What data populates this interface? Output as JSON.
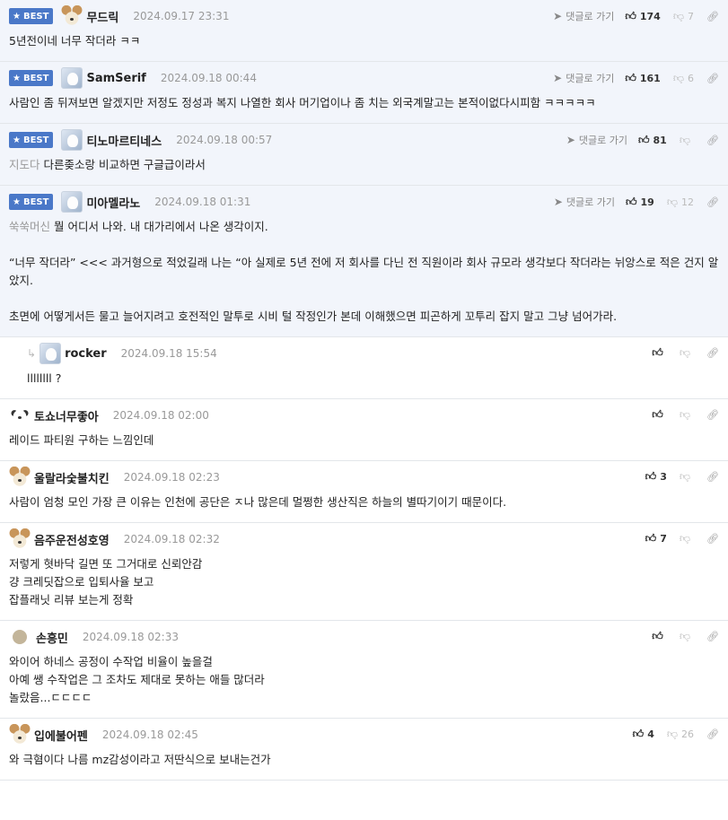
{
  "labels": {
    "best": "BEST",
    "reply": "댓글로 가기"
  },
  "comments": [
    {
      "best": true,
      "avatar": "dog",
      "name": "무드릭",
      "date": "2024.09.17 23:31",
      "up": "174",
      "down": "7",
      "quote": "",
      "text": "5년전이네 너무 작더라 ㅋㅋ"
    },
    {
      "best": true,
      "avatar": "photo",
      "name": "SamSerif",
      "date": "2024.09.18 00:44",
      "up": "161",
      "down": "6",
      "quote": "",
      "text": "사람인 좀 뒤져보면 알겠지만 저정도 정성과 복지 나열한 회사 머기업이나 좀 치는 외국계말고는 본적이없다시피함 ㅋㅋㅋㅋㅋ"
    },
    {
      "best": true,
      "avatar": "photo",
      "name": "티노마르티네스",
      "date": "2024.09.18 00:57",
      "up": "81",
      "down": "",
      "quote": "지도다",
      "text": " 다른좆소랑 비교하면 구글급이라서"
    },
    {
      "best": true,
      "avatar": "photo",
      "name": "미아멜라노",
      "date": "2024.09.18 01:31",
      "up": "19",
      "down": "12",
      "quote": "쑥쑥머신",
      "text": " 뭘 어디서 나와. 내 대가리에서 나온 생각이지.\n\n“너무 작더라” <<< 과거형으로 적었길래 나는 “아 실제로 5년 전에 저 회사를 다닌 전 직원이라 회사 규모라 생각보다 작더라는 뉘앙스로 적은 건지 알았지.\n\n초면에 어떻게서든 물고 늘어지려고 호전적인 말투로 시비 털 작정인가 본데 이해했으면 피곤하게 꼬투리 잡지 말고 그냥 넘어가라."
    },
    {
      "best": false,
      "reply": true,
      "avatar": "photo",
      "name": "rocker",
      "date": "2024.09.18 15:54",
      "up": "",
      "down": "",
      "quote": "",
      "text": "llllllll ?"
    },
    {
      "best": false,
      "avatar": "puppy",
      "name": "토쇼너무좋아",
      "date": "2024.09.18 02:00",
      "up": "",
      "down": "",
      "quote": "",
      "text": "레이드 파티원 구하는 느낌인데"
    },
    {
      "best": false,
      "avatar": "dog",
      "name": "울랄라숯불치킨",
      "date": "2024.09.18 02:23",
      "up": "3",
      "down": "",
      "quote": "",
      "text": "사람이 엄청 모인 가장 큰 이유는 인천에 공단은 ㅈ나 많은데 멀쩡한 생산직은 하늘의 별따기이기 때문이다."
    },
    {
      "best": false,
      "avatar": "dog",
      "name": "음주운전성호영",
      "date": "2024.09.18 02:32",
      "up": "7",
      "down": "",
      "quote": "",
      "text": "저렇게 혓바닥 길면 또 그거대로 신뢰안감\n걍 크레딧잡으로 입퇴사율 보고\n잡플래닛 리뷰 보는게 정확"
    },
    {
      "best": false,
      "avatar": "dot",
      "name": "손흥민",
      "date": "2024.09.18 02:33",
      "up": "",
      "down": "",
      "quote": "",
      "text": "와이어 하네스 공정이 수작업 비율이 높을걸\n아예 쌩 수작업은 그 조차도 제대로 못하는 애들 많더라\n놀랐음...ㄷㄷㄷㄷ"
    },
    {
      "best": false,
      "avatar": "dog",
      "name": "입에불어펜",
      "date": "2024.09.18 02:45",
      "up": "4",
      "down": "26",
      "quote": "",
      "text": "와 극혐이다 나름 mz감성이라고 저딴식으로 보내는건가"
    }
  ]
}
